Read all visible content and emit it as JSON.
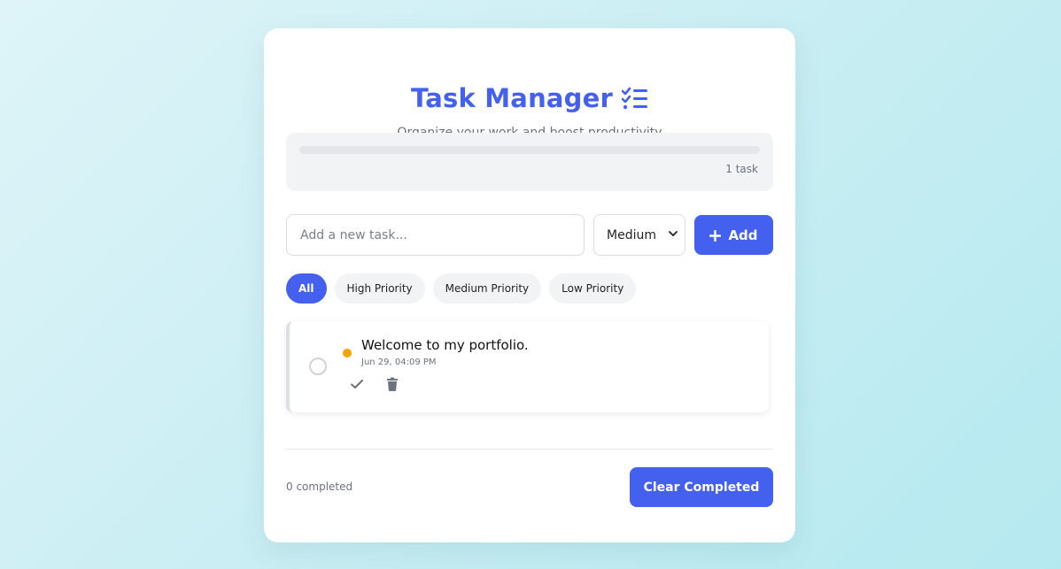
{
  "header": {
    "title": "Task Manager",
    "title_icon": "list-check-icon",
    "subtitle": "Organize your work and boost productivity"
  },
  "progress": {
    "completed_fraction": 0,
    "count_label": "1 task"
  },
  "new_task": {
    "placeholder": "Add a new task...",
    "value": "",
    "priority_selected": "Medium",
    "add_label": "Add",
    "add_icon": "plus-icon"
  },
  "filters": [
    {
      "label": "All",
      "active": true
    },
    {
      "label": "High Priority",
      "active": false
    },
    {
      "label": "Medium Priority",
      "active": false
    },
    {
      "label": "Low Priority",
      "active": false
    }
  ],
  "tasks": [
    {
      "text": "Welcome to my portfolio.",
      "date": "Jun 29, 04:09 PM",
      "priority_color": "#f4a300",
      "completed": false
    }
  ],
  "footer": {
    "completed_label": "0 completed",
    "clear_label": "Clear Completed"
  },
  "colors": {
    "accent": "#4361ee",
    "medium_priority": "#f4a300"
  }
}
